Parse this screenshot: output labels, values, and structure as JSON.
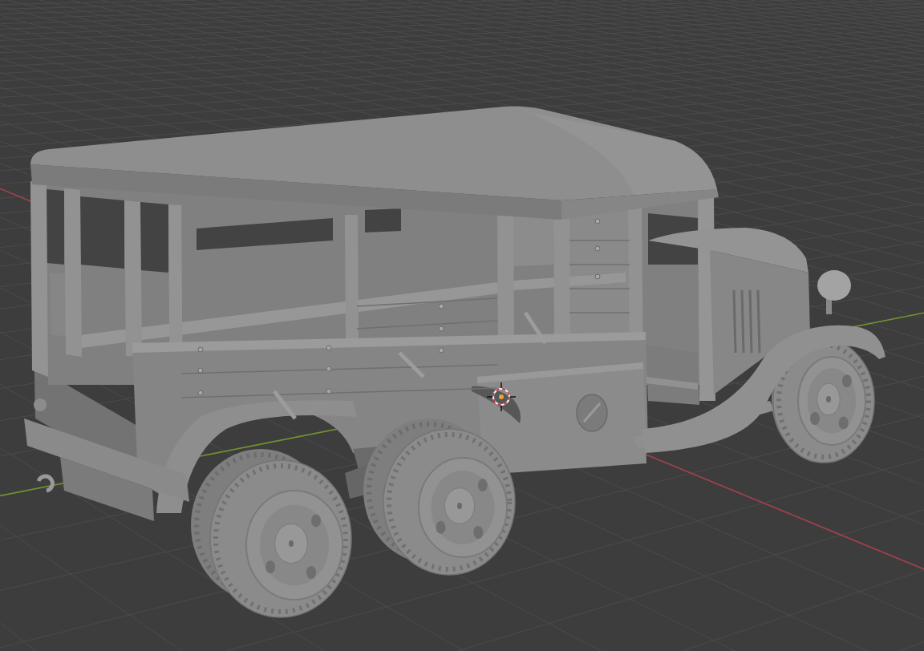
{
  "viewport": {
    "axes": [
      {
        "kind": "x",
        "color": "#a5414c"
      },
      {
        "kind": "y",
        "color": "#71922d"
      }
    ]
  }
}
